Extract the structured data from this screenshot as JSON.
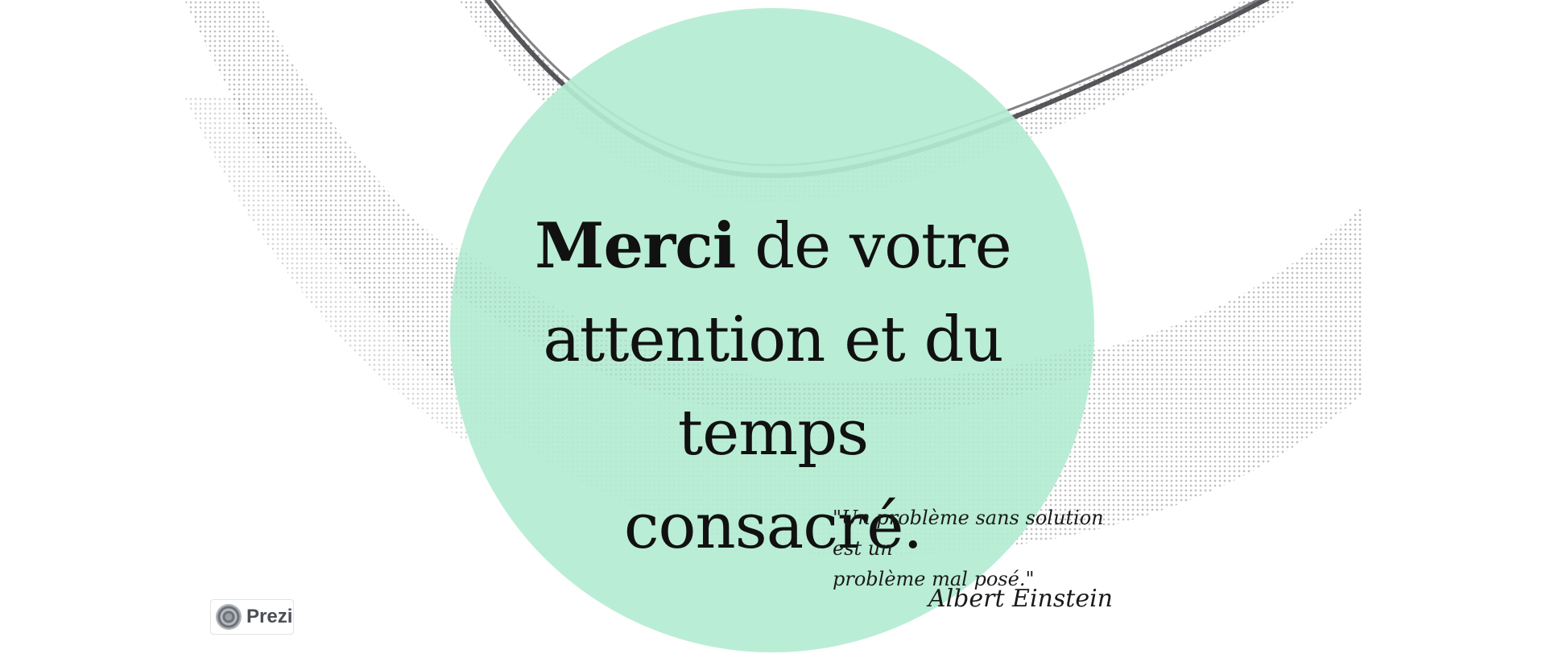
{
  "slide": {
    "title_strong": "Merci",
    "title_rest_line1": " de votre",
    "title_line2": "attention et du",
    "title_line3": "temps consacré.",
    "quote_line1": "\"Un problème sans solution est un",
    "quote_line2": "problème mal posé.\"",
    "author": "Albert Einstein"
  },
  "badge": {
    "label": "Prezi",
    "icon": "prezi-logo-icon"
  },
  "colors": {
    "circle": "#b4ecd2",
    "background": "#ffffff",
    "text": "#111111",
    "halftone": "#9a9a9a",
    "ring": "#3a3a3e"
  }
}
